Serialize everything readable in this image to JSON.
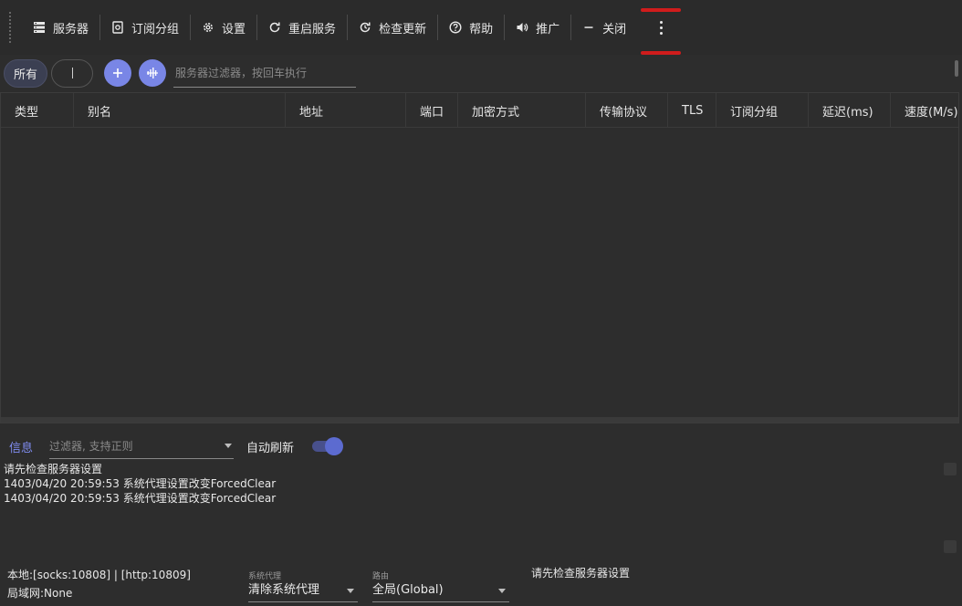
{
  "toolbar": {
    "servers": "服务器",
    "subscriptions": "订阅分组",
    "settings": "设置",
    "restart": "重启服务",
    "check_update": "检查更新",
    "help": "帮助",
    "promote": "推广",
    "close": "关闭",
    "more_icon": "more-vert-icon"
  },
  "filters": {
    "all_chip": "所有",
    "empty_chip": "",
    "add_icon": "plus-icon",
    "speed_icon": "equalizer-icon",
    "server_filter_placeholder": "服务器过滤器，按回车执行"
  },
  "grid": {
    "columns": [
      "类型",
      "别名",
      "地址",
      "端口",
      "加密方式",
      "传输协议",
      "TLS",
      "订阅分组",
      "延迟(ms)",
      "速度(M/s)"
    ],
    "rows": []
  },
  "log": {
    "tab": "信息",
    "filter_placeholder": "过滤器, 支持正则",
    "auto_refresh_label": "自动刷新",
    "auto_refresh_on": true,
    "lines": [
      "请先检查服务器设置",
      "1403/04/20 20:59:53 系统代理设置改变ForcedClear",
      "1403/04/20 20:59:53 系统代理设置改变ForcedClear"
    ]
  },
  "status": {
    "local": "本地:[socks:10808] | [http:10809]",
    "lan": "局域网:None",
    "sysproxy_caption": "系统代理",
    "sysproxy_value": "清除系统代理",
    "route_caption": "路由",
    "route_value": "全局(Global)",
    "message": "请先检查服务器设置"
  },
  "colors": {
    "accent": "#7986e6",
    "highlight_mark": "#d01c1c",
    "background": "#2d2d2d"
  }
}
